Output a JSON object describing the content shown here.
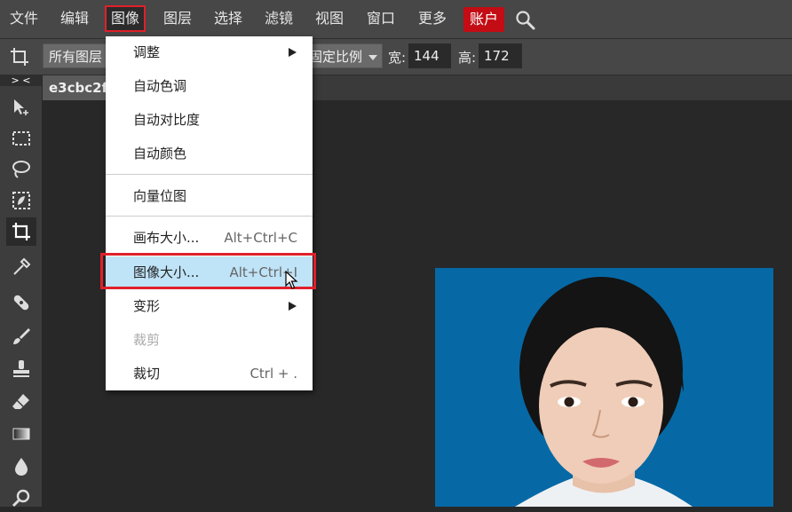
{
  "menubar": {
    "items": [
      "文件",
      "编辑",
      "图像",
      "图层",
      "选择",
      "滤镜",
      "视图",
      "窗口",
      "更多"
    ],
    "active_index": 2,
    "account_label": "账户",
    "account_color": "#c30c14",
    "search_icon": "search-icon"
  },
  "options": {
    "tool_icon": "crop-icon",
    "layers_dropdown": "所有图层",
    "ratio_dropdown": "固定比例",
    "width_label": "宽:",
    "width_value": "144",
    "height_label": "高:",
    "height_value": "172"
  },
  "toolbar": {
    "collapse_label": "> <",
    "tools": [
      "move-tool-icon",
      "marquee-tool-icon",
      "lasso-tool-icon",
      "quick-select-tool-icon",
      "crop-tool-icon",
      "eyedropper-tool-icon",
      "healing-tool-icon",
      "brush-tool-icon",
      "stamp-tool-icon",
      "eraser-tool-icon",
      "gradient-tool-icon",
      "blur-tool-icon",
      "zoom-tool-icon"
    ],
    "active_tool": "crop-tool-icon"
  },
  "document": {
    "tab_label": "e3cbc2f4",
    "photo_background": "#0669a6"
  },
  "image_menu": {
    "items": [
      {
        "label": "调整",
        "submenu": true
      },
      {
        "label": "自动色调"
      },
      {
        "label": "自动对比度"
      },
      {
        "label": "自动颜色"
      },
      {
        "label": "向量位图"
      },
      {
        "label": "画布大小...",
        "shortcut": "Alt+Ctrl+C"
      },
      {
        "label": "图像大小...",
        "shortcut": "Alt+Ctrl+I",
        "highlighted": true
      },
      {
        "label": "变形",
        "submenu": true
      },
      {
        "label": "裁剪",
        "disabled": true
      },
      {
        "label": "裁切",
        "shortcut": "Ctrl + ."
      }
    ],
    "highlight_color": "#bfe3f7",
    "annotation_color": "#e0202a"
  }
}
